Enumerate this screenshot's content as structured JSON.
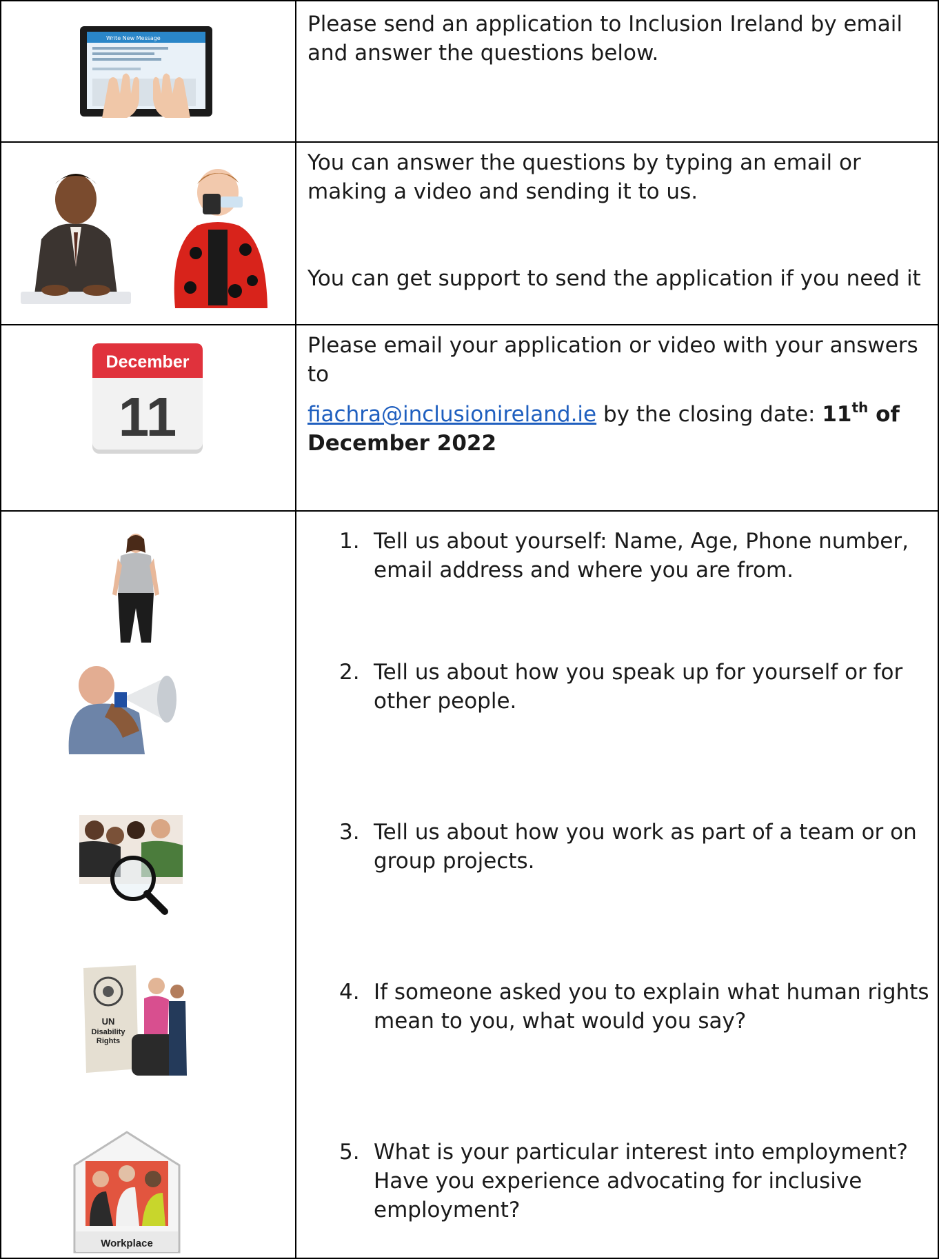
{
  "rows": [
    {
      "text": "Please send an application to Inclusion Ireland by email and answer the questions below.",
      "icons": {
        "tablet": "tablet-typing-icon",
        "screen_title": "Write New Message"
      }
    },
    {
      "text1": "You can answer the questions by typing an email or making a video and sending it to us.",
      "text2": "You can get support to send the application if you need it",
      "icons": {
        "left": "man-typing-keyboard-icon",
        "right": "woman-filming-video-icon"
      }
    },
    {
      "text_lead": "Please email your application or video with your answers to",
      "email": "fiachra@inclusionireland.ie",
      "text_mid": " by the closing date: ",
      "date_day": "11",
      "date_sup": "th",
      "date_rest": " of December 2022",
      "calendar": {
        "month": "December",
        "day": "11"
      }
    }
  ],
  "questions": [
    {
      "num": "1.",
      "text": "Tell us about yourself: Name, Age, Phone number, email address and where you are from.",
      "icon": "standing-woman-icon"
    },
    {
      "num": "2.",
      "text": "Tell us about how you speak up for yourself or for other people.",
      "icon": "man-with-megaphone-icon"
    },
    {
      "num": "3.",
      "text": "Tell us about how you work as part of a team or on group projects.",
      "icon": "group-with-magnifier-icon"
    },
    {
      "num": "4.",
      "text": "If someone asked you to explain what human rights mean to you, what would you say?",
      "icon": "un-disability-rights-icon",
      "badge": "UN Disability Rights"
    },
    {
      "num": "5.",
      "text": "What is your particular interest into employment? Have you experience advocating for inclusive employment?",
      "icon": "workplace-icon",
      "badge": "Workplace"
    }
  ],
  "colors": {
    "link": "#1f5fbf",
    "calendar_red": "#e0323c",
    "border": "#000000"
  }
}
